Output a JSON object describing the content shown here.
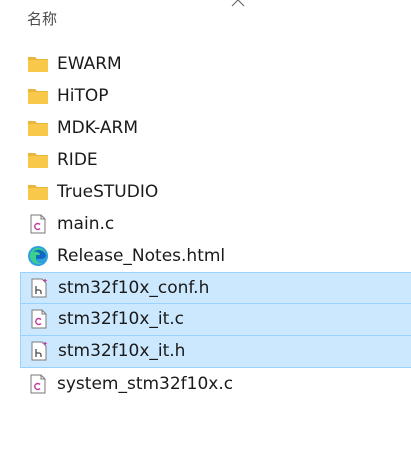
{
  "header": {
    "column_label": "名称",
    "sort_icon": "chevron-up-icon"
  },
  "files": [
    {
      "name": "EWARM",
      "type": "folder",
      "icon": "folder-icon",
      "selected": false
    },
    {
      "name": "HiTOP",
      "type": "folder",
      "icon": "folder-icon",
      "selected": false
    },
    {
      "name": "MDK-ARM",
      "type": "folder",
      "icon": "folder-icon",
      "selected": false
    },
    {
      "name": "RIDE",
      "type": "folder",
      "icon": "folder-icon",
      "selected": false
    },
    {
      "name": "TrueSTUDIO",
      "type": "folder",
      "icon": "folder-icon",
      "selected": false
    },
    {
      "name": "main.c",
      "type": "c-file",
      "icon": "c-file-icon",
      "selected": false
    },
    {
      "name": "Release_Notes.html",
      "type": "html-file",
      "icon": "edge-browser-icon",
      "selected": false
    },
    {
      "name": "stm32f10x_conf.h",
      "type": "h-file",
      "icon": "h-file-icon",
      "selected": true
    },
    {
      "name": "stm32f10x_it.c",
      "type": "c-file",
      "icon": "c-file-icon",
      "selected": true
    },
    {
      "name": "stm32f10x_it.h",
      "type": "h-file",
      "icon": "h-file-icon",
      "selected": true
    },
    {
      "name": "system_stm32f10x.c",
      "type": "c-file",
      "icon": "c-file-icon",
      "selected": false
    }
  ],
  "colors": {
    "selection_bg": "#cce8ff",
    "selection_border": "#99d1ff",
    "folder": "#f8c84a",
    "file_outline": "#7a7a7a",
    "h_sparkle": "#c03b9a"
  }
}
